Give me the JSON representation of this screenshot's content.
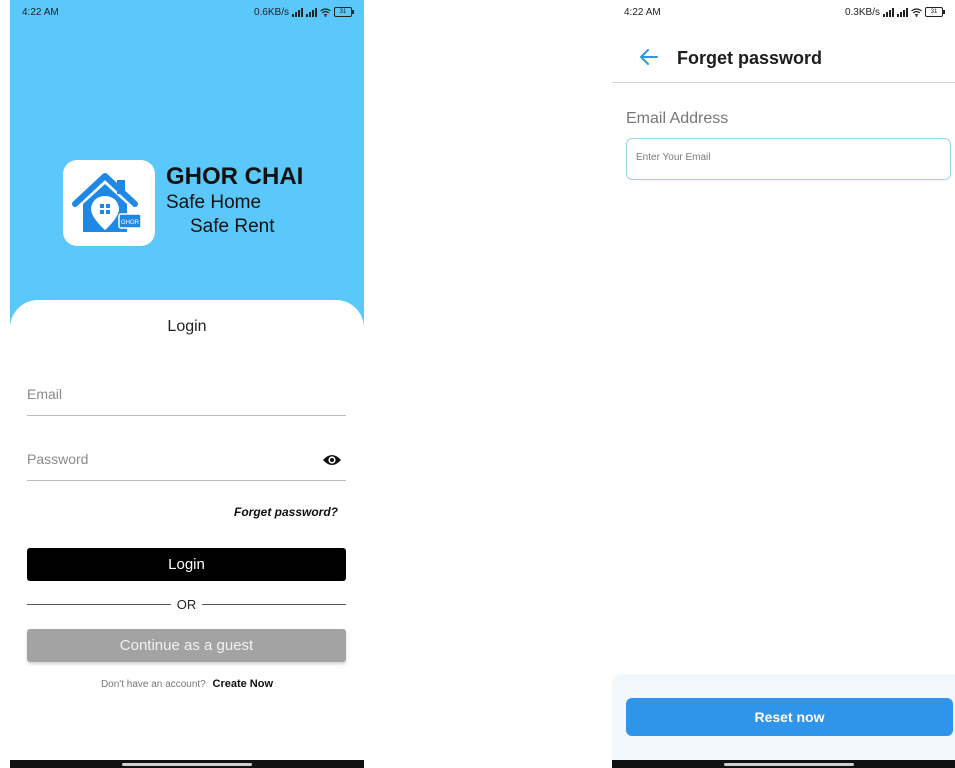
{
  "left_screen": {
    "status": {
      "time": "4:22 AM",
      "speed": "0.6KB/s",
      "battery": "31"
    },
    "brand": {
      "title": "GHOR CHAI",
      "line1": "Safe Home",
      "line2": "Safe Rent",
      "logo_badge": "GHOR"
    },
    "login": {
      "title": "Login",
      "email_placeholder": "Email",
      "password_placeholder": "Password",
      "forget_link": "Forget password?",
      "login_button": "Login",
      "or_text": "OR",
      "guest_button": "Continue as a guest",
      "no_account_text": "Don't have an account?",
      "create_link": "Create Now"
    }
  },
  "right_screen": {
    "status": {
      "time": "4:22 AM",
      "speed": "0.3KB/s",
      "battery": "31"
    },
    "appbar": {
      "title": "Forget password"
    },
    "form": {
      "label": "Email Address",
      "placeholder": "Enter Your Email"
    },
    "reset_button": "Reset now"
  },
  "colors": {
    "hero": "#5ac8fa",
    "primary_blue": "#2f95ea",
    "logo_blue": "#1e88e5"
  }
}
